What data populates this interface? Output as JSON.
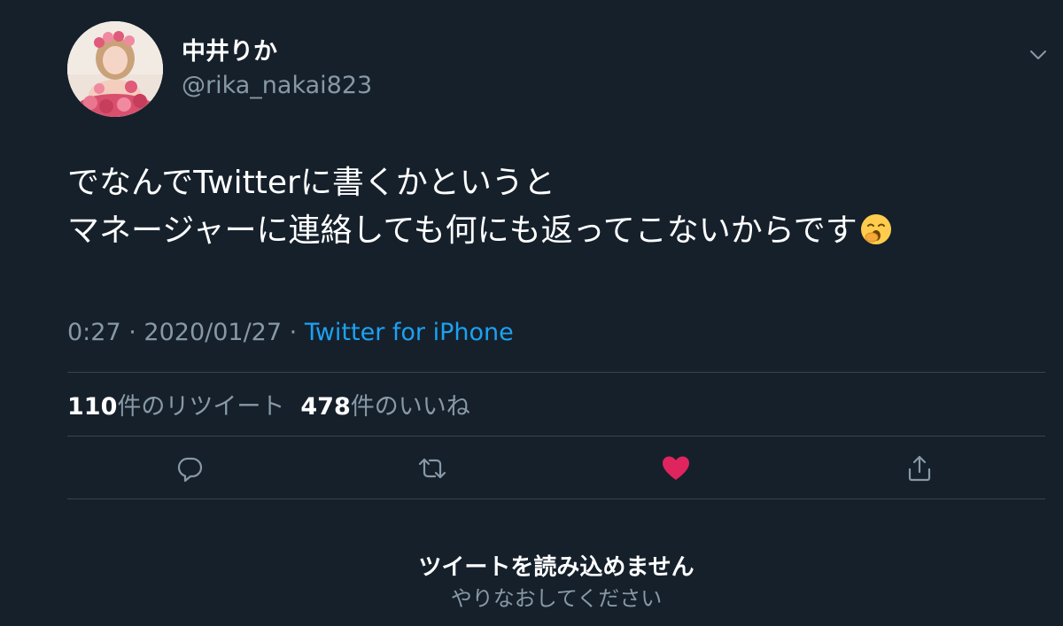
{
  "tweet": {
    "display_name": "中井りか",
    "handle": "@rika_nakai823",
    "body_lines": [
      "でなんでTwitterに書くかというと",
      "マネージャーに連絡しても何にも返ってこないからです"
    ],
    "body_emoji": "yawning-face-emoji",
    "time": "0:27",
    "date": "2020/01/27",
    "separator": "·",
    "source": "Twitter for iPhone",
    "retweet_count": "110",
    "retweet_label": "件のリツイート",
    "like_count": "478",
    "like_label": "件のいいね"
  },
  "actions": {
    "reply_icon": "reply-icon",
    "retweet_icon": "retweet-icon",
    "like_icon": "heart-icon",
    "share_icon": "share-icon"
  },
  "error": {
    "title": "ツイートを読み込めません",
    "subtitle": "やりなおしてください"
  },
  "colors": {
    "background": "#15202b",
    "secondary_text": "#8899a6",
    "link": "#1da1f2",
    "liked": "#e0245e",
    "divider": "#38444d"
  }
}
